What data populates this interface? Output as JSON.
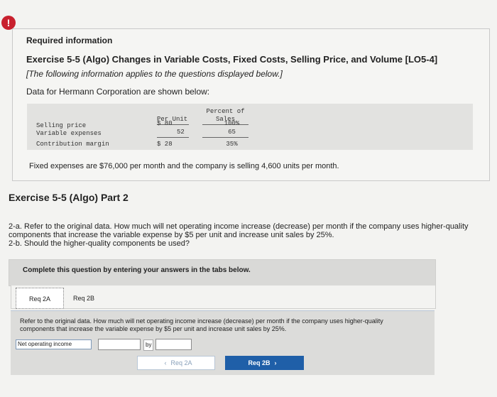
{
  "alert": {
    "symbol": "!"
  },
  "header": {
    "required": "Required information",
    "title": "Exercise 5-5 (Algo) Changes in Variable Costs, Fixed Costs, Selling Price, and Volume [LO5-4]",
    "applies": "[The following information applies to the questions displayed below.]",
    "data_intro": "Data for Hermann Corporation are shown below:"
  },
  "table": {
    "col_unit": "Per Unit",
    "col_pct_line1": "Percent of",
    "col_pct_line2": "Sales",
    "rows": [
      {
        "label": "Selling price",
        "unit": "$ 80",
        "pct": "100%"
      },
      {
        "label": "Variable expenses",
        "unit": "52",
        "pct": "65"
      },
      {
        "label": "Contribution margin",
        "unit": "$ 28",
        "pct": "35%"
      }
    ]
  },
  "fixed_text": "Fixed expenses are $76,000 per month and the company is selling 4,600 units per month.",
  "part": {
    "title": "Exercise 5-5 (Algo) Part 2",
    "question_a": "2-a. Refer to the original data. How much will net operating income increase (decrease) per month if the company uses higher-quality components that increase the variable expense by $5 per unit and increase unit sales by 25%.",
    "question_b": "2-b. Should the higher-quality components be used?"
  },
  "banner": "Complete this question by entering your answers in the tabs below.",
  "tabs": [
    {
      "label": "Req 2A"
    },
    {
      "label": "Req 2B"
    }
  ],
  "panel": {
    "text": "Refer to the original data. How much will net operating income increase (decrease) per month if the company uses higher-quality components that increase the variable expense by $5 per unit and increase unit sales by 25%.",
    "noi_label": "Net operating income",
    "noi_value": "",
    "by_label": "by",
    "by_value": ""
  },
  "nav": {
    "prev_label": "Req 2A",
    "next_label": "Req 2B"
  },
  "colors": {
    "accent": "#1f5fa8",
    "alert": "#c8202e"
  }
}
